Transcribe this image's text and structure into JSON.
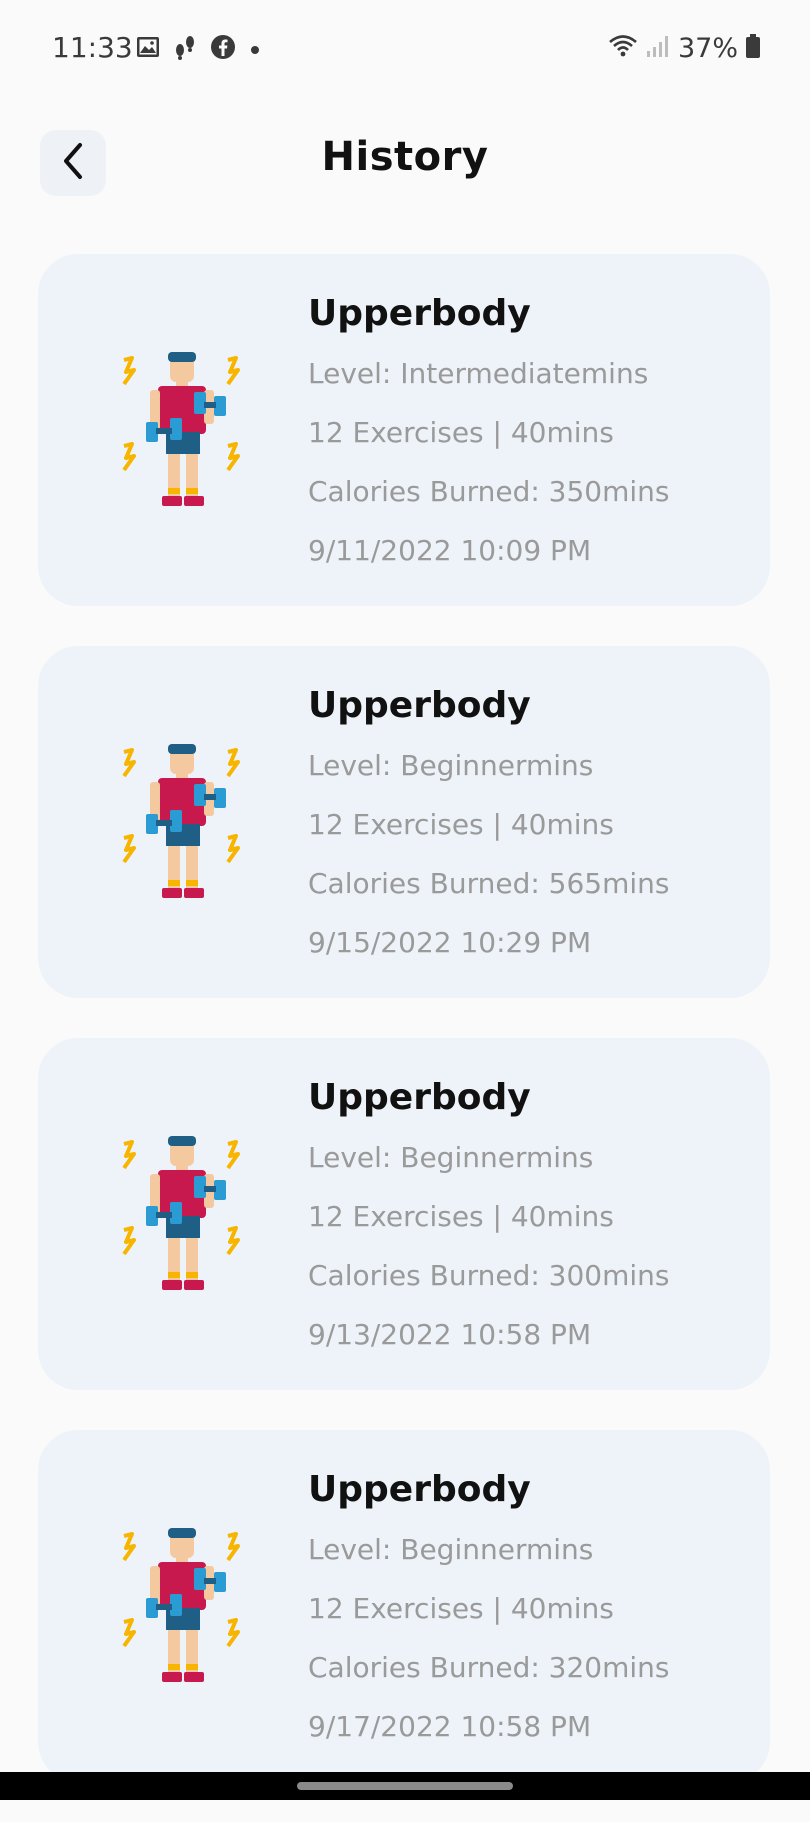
{
  "status_bar": {
    "time": "11:33",
    "battery": "37%",
    "left_icons": [
      "image-icon",
      "steps-icon",
      "facebook-icon",
      "dot-icon"
    ],
    "right_icons": [
      "wifi-icon",
      "signal-icon",
      "battery-icon"
    ]
  },
  "header": {
    "title": "History",
    "back_icon": "chevron-left-icon"
  },
  "history": [
    {
      "title": "Upperbody",
      "level": "Level: Intermediatemins",
      "exercises": "12 Exercises | 40mins",
      "calories": "Calories Burned: 350mins",
      "date": "9/11/2022 10:09 PM"
    },
    {
      "title": "Upperbody",
      "level": "Level: Beginnermins",
      "exercises": "12 Exercises | 40mins",
      "calories": "Calories Burned: 565mins",
      "date": "9/15/2022 10:29 PM"
    },
    {
      "title": "Upperbody",
      "level": "Level: Beginnermins",
      "exercises": "12 Exercises | 40mins",
      "calories": "Calories Burned: 300mins",
      "date": "9/13/2022 10:58 PM"
    },
    {
      "title": "Upperbody",
      "level": "Level: Beginnermins",
      "exercises": "12 Exercises | 40mins",
      "calories": "Calories Burned: 320mins",
      "date": "9/17/2022 10:58 PM"
    }
  ],
  "colors": {
    "card_bg": "#edf3f8",
    "page_bg": "#fafafa",
    "shirt": "#c8194f",
    "shorts": "#1f5f86",
    "dumbbell": "#2b9bd4",
    "bolt": "#f7b500",
    "skin": "#f4c9a0"
  }
}
